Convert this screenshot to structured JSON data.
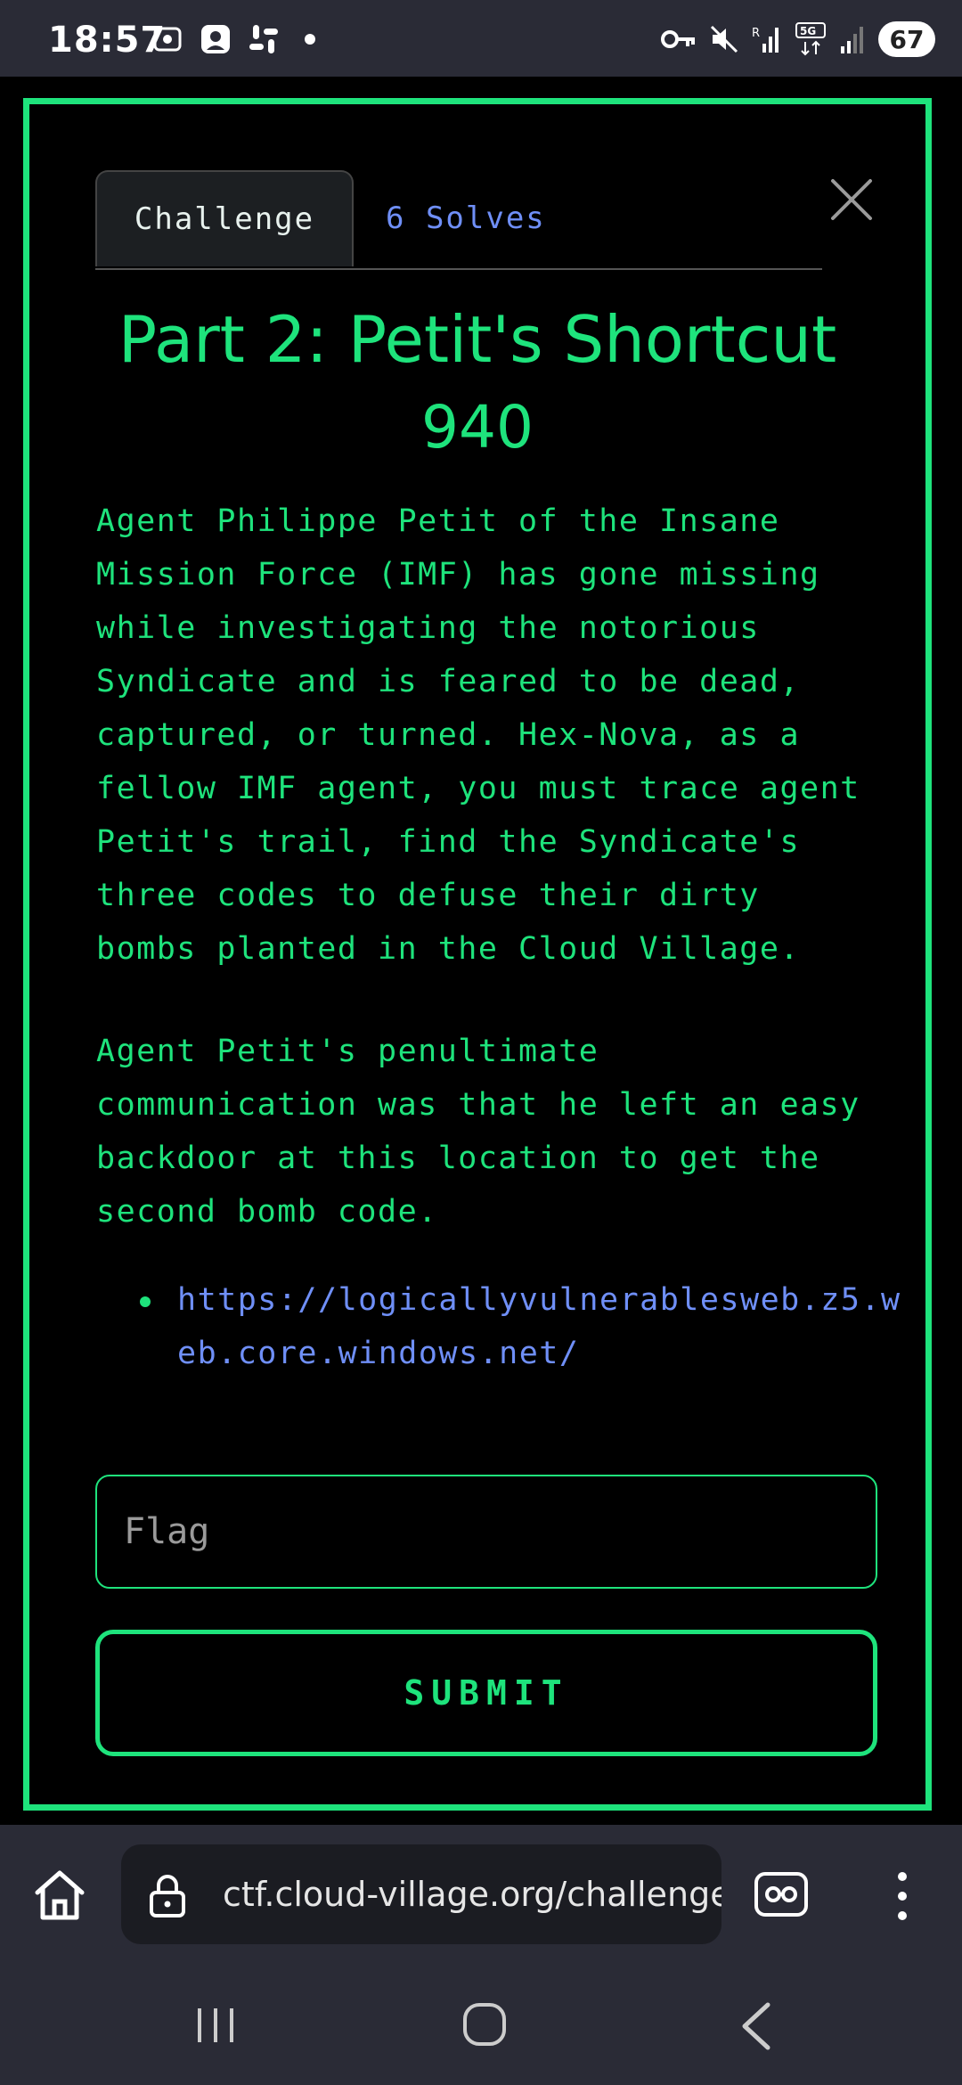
{
  "status_bar": {
    "time": "18:57",
    "battery": "67",
    "left_icons": [
      "screenshot-icon",
      "profile-icon",
      "slack-icon",
      "dot-icon"
    ],
    "right_icons": [
      "vpn-key-icon",
      "mute-icon",
      "signal-r-icon",
      "5g-icon",
      "signal-icon"
    ]
  },
  "modal": {
    "tabs": [
      {
        "label": "Challenge",
        "active": true
      },
      {
        "label": "6 Solves",
        "active": false
      }
    ],
    "title": "Part 2: Petit's Shortcut",
    "points": "940",
    "description": [
      "Agent Philippe Petit of the Insane Mission Force (IMF) has gone missing while investigating the notorious Syndicate and is feared to be dead, captured, or turned. Hex-Nova, as a fellow IMF agent, you must trace agent Petit's trail, find the Syndicate's three codes to defuse their dirty bombs planted in the Cloud Village.",
      "Agent Petit's penultimate communication was that he left an easy backdoor at this location to get the second bomb code."
    ],
    "link": "https://logicallyvulnerablesweb.z5.web.core.windows.net/",
    "flag_placeholder": "Flag",
    "submit_label": "SUBMIT",
    "accent_color": "#1ee37c",
    "link_color": "#6f8ff7"
  },
  "browser": {
    "url": "ctf.cloud-village.org/challenges"
  }
}
